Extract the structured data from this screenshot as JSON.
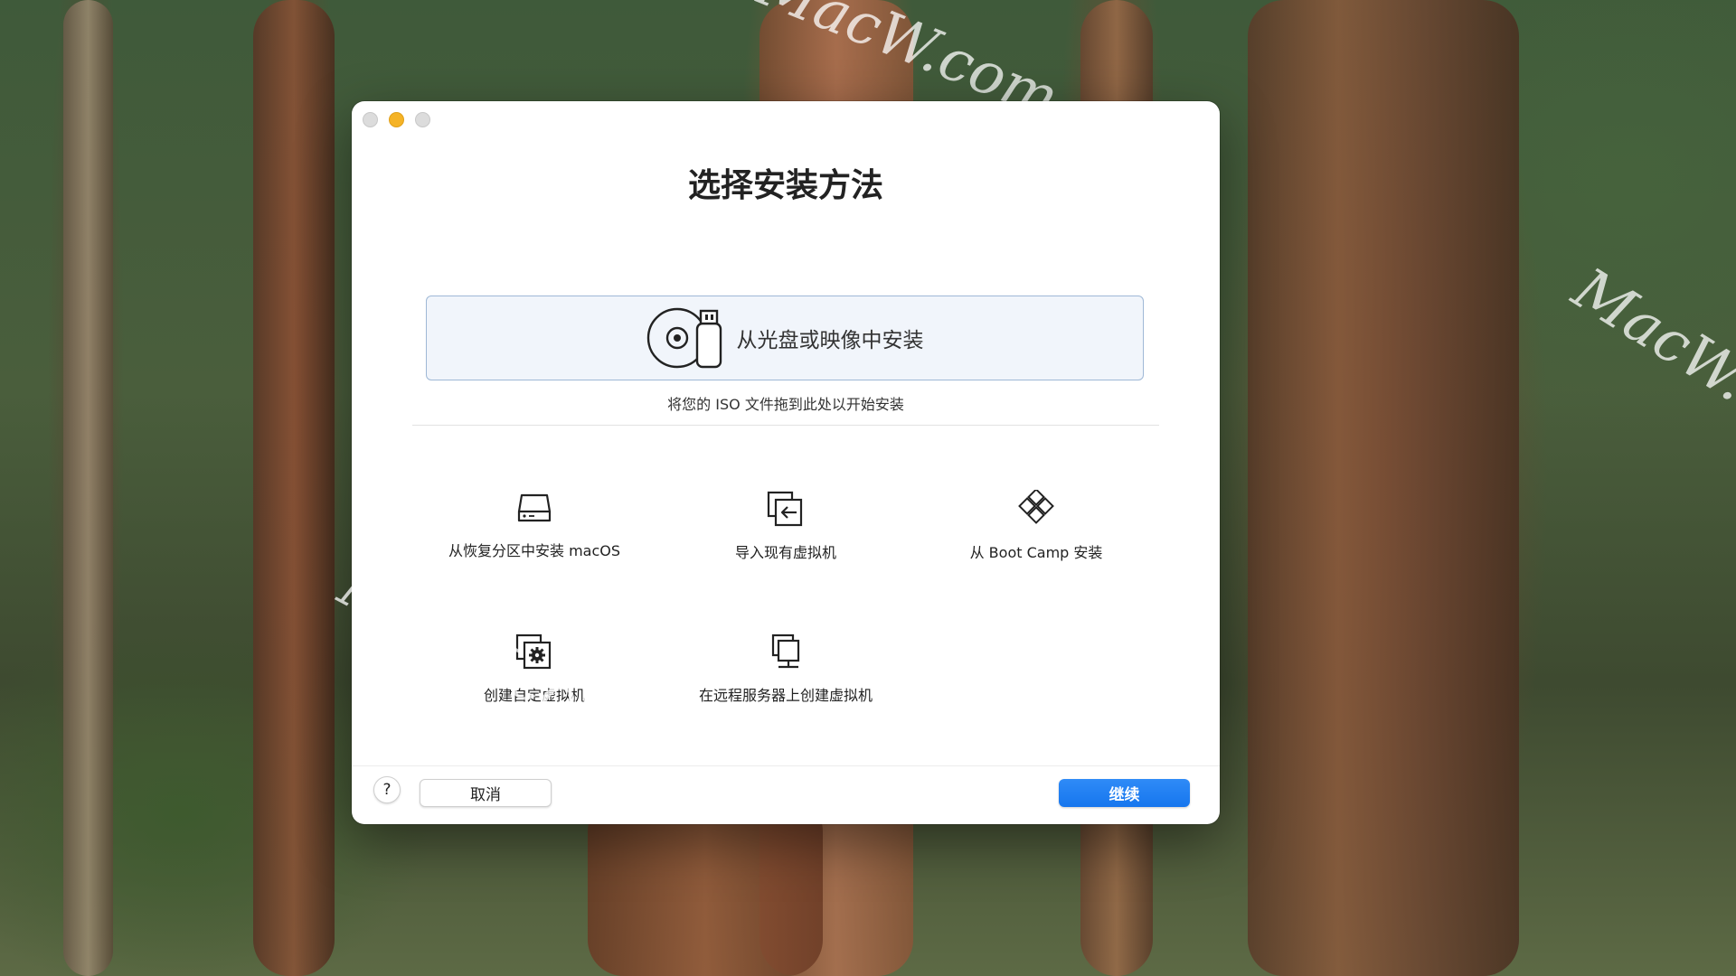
{
  "dialog": {
    "title": "选择安装方法",
    "dropzone_label": "从光盘或映像中安装",
    "drop_hint": "将您的 ISO 文件拖到此处以开始安装",
    "options": [
      {
        "label": "从恢复分区中安装 macOS",
        "icon": "hard-drive-icon"
      },
      {
        "label": "导入现有虚拟机",
        "icon": "import-vm-icon"
      },
      {
        "label": "从 Boot Camp 安装",
        "icon": "bootcamp-diamond-icon"
      },
      {
        "label": "创建自定虚拟机",
        "icon": "custom-vm-gear-icon"
      },
      {
        "label": "在远程服务器上创建虚拟机",
        "icon": "remote-server-icon"
      }
    ],
    "help_label": "?",
    "cancel_label": "取消",
    "continue_label": "继续"
  },
  "watermark": {
    "text": "MacW.com"
  },
  "colors": {
    "accent": "#1676ee",
    "dropzone_border": "#9fb8d6",
    "dropzone_bg": "#f1f5fb",
    "minimize_light": "#f5b326"
  }
}
